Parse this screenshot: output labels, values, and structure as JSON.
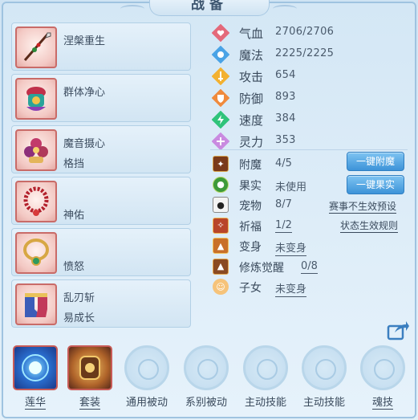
{
  "title": "战备",
  "equipment": [
    {
      "name": "涅槃重生",
      "sub": "",
      "icon": "spear-icon"
    },
    {
      "name": "群体净心",
      "sub": "",
      "icon": "ornate-armor-icon"
    },
    {
      "name": "魔音摄心",
      "sub": "格挡",
      "icon": "flower-charm-icon"
    },
    {
      "name": "",
      "sub": "神佑",
      "icon": "bead-necklace-icon"
    },
    {
      "name": "",
      "sub": "愤怒",
      "icon": "gold-necklace-icon"
    },
    {
      "name": "乱刃斩",
      "sub": "易成长",
      "icon": "boots-icon"
    }
  ],
  "stats": [
    {
      "label": "气血",
      "value": "2706/2706",
      "icon": "heart-icon",
      "color": "#e4697a"
    },
    {
      "label": "魔法",
      "value": "2225/2225",
      "icon": "mana-icon",
      "color": "#4aa3e6"
    },
    {
      "label": "攻击",
      "value": "654",
      "icon": "attack-icon",
      "color": "#f3b130"
    },
    {
      "label": "防御",
      "value": "893",
      "icon": "shield-icon",
      "color": "#f08a3c"
    },
    {
      "label": "速度",
      "value": "384",
      "icon": "speed-icon",
      "color": "#2fc37a"
    },
    {
      "label": "灵力",
      "value": "353",
      "icon": "spirit-icon",
      "color": "#c98ae0"
    }
  ],
  "info": {
    "enchant": {
      "label": "附魔",
      "value": "4/5",
      "icon": "enchant-icon"
    },
    "fruit": {
      "label": "果实",
      "value": "未使用",
      "icon": "fruit-icon"
    },
    "pet": {
      "label": "宠物",
      "value": "8/7",
      "icon": "panda-icon"
    },
    "bless": {
      "label": "祈福",
      "value": "1/2",
      "icon": "bless-icon"
    },
    "transform": {
      "label": "变身",
      "value": "未变身",
      "icon": "transform-icon"
    },
    "awaken": {
      "label": "修炼觉醒",
      "value": "0/8",
      "icon": "awaken-icon"
    },
    "child": {
      "label": "子女",
      "value": "未变身",
      "icon": "child-icon"
    }
  },
  "buttons": {
    "one_click_enchant": "一键附魔",
    "one_click_fruit": "一键果实"
  },
  "links": {
    "event_preset": "赛事不生效预设",
    "status_rules": "状态生效规则"
  },
  "skills": [
    {
      "label": "莲华",
      "type": "orb",
      "icon": "lotus-orb-icon"
    },
    {
      "label": "套装",
      "type": "set",
      "icon": "armor-set-icon"
    },
    {
      "label": "通用被动",
      "type": "empty",
      "icon": "empty-slot-icon"
    },
    {
      "label": "系别被动",
      "type": "empty",
      "icon": "empty-slot-icon"
    },
    {
      "label": "主动技能",
      "type": "empty",
      "icon": "empty-slot-icon"
    },
    {
      "label": "主动技能",
      "type": "empty",
      "icon": "empty-slot-icon"
    },
    {
      "label": "魂技",
      "type": "empty",
      "icon": "empty-slot-icon"
    }
  ]
}
